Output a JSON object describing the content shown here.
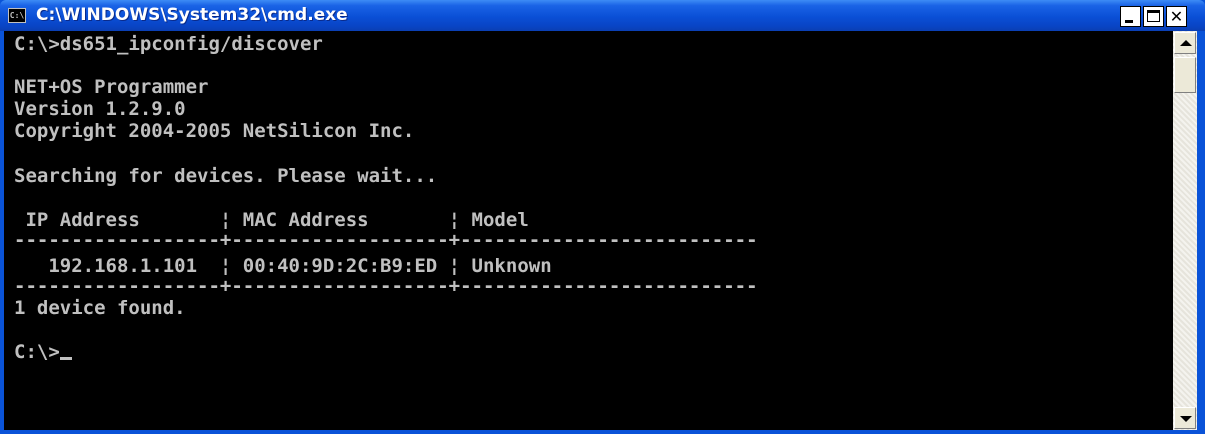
{
  "window": {
    "title": "C:\\WINDOWS\\System32\\cmd.exe",
    "icon_text": "C:\\",
    "controls": {
      "minimize_icon": "minimize-icon",
      "maximize_icon": "maximize-icon",
      "close_icon": "close-icon",
      "close_glyph": "✕"
    },
    "colors": {
      "titlebar": "#0a53d8",
      "console_background": "#000000",
      "console_text": "#c0c0c0"
    }
  },
  "console": {
    "lines": [
      "C:\\>ds651_ipconfig/discover",
      "",
      "NET+OS Programmer",
      "Version 1.2.9.0",
      "Copyright 2004-2005 NetSilicon Inc.",
      "",
      "Searching for devices. Please wait...",
      "",
      " IP Address       ¦ MAC Address       ¦ Model",
      "------------------+-------------------+--------------------------",
      "   192.168.1.101  ¦ 00:40:9D:2C:B9:ED ¦ Unknown",
      "------------------+-------------------+--------------------------",
      "1 device found.",
      "",
      "C:\\>"
    ]
  },
  "scrollbar": {
    "up_icon": "scroll-up-arrow-icon",
    "down_icon": "scroll-down-arrow-icon"
  }
}
